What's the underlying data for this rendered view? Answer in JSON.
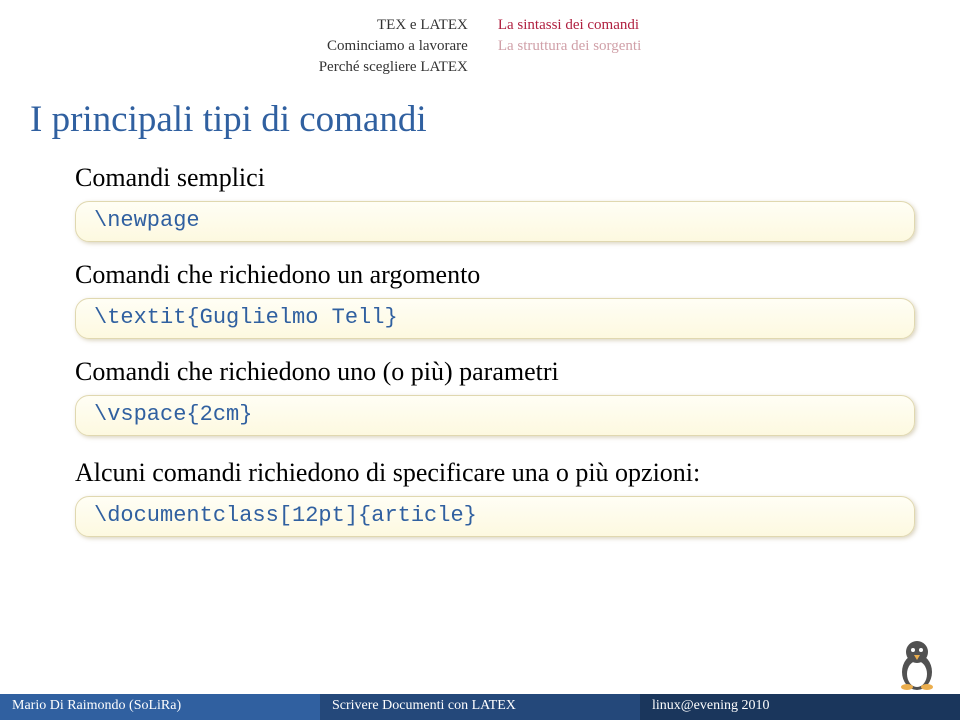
{
  "header": {
    "left_lines": [
      "TEX e LATEX",
      "Cominciamo a lavorare",
      "Perché scegliere LATEX"
    ],
    "right_active": "La sintassi dei comandi",
    "right_inactive": "La struttura dei sorgenti"
  },
  "title": "I principali tipi di comandi",
  "sections": [
    {
      "label": "Comandi semplici",
      "code": "\\newpage"
    },
    {
      "label": "Comandi che richiedono un argomento",
      "code": "\\textit{Guglielmo Tell}"
    },
    {
      "label": "Comandi che richiedono uno (o più) parametri",
      "code": "\\vspace{2cm}"
    }
  ],
  "options_label": "Alcuni comandi richiedono di specificare una o più opzioni:",
  "options_code": "\\documentclass[12pt]{article}",
  "footer": {
    "left": "Mario Di Raimondo (SoLiRa)",
    "center": "Scrivere Documenti con LATEX",
    "right": "linux@evening 2010"
  }
}
